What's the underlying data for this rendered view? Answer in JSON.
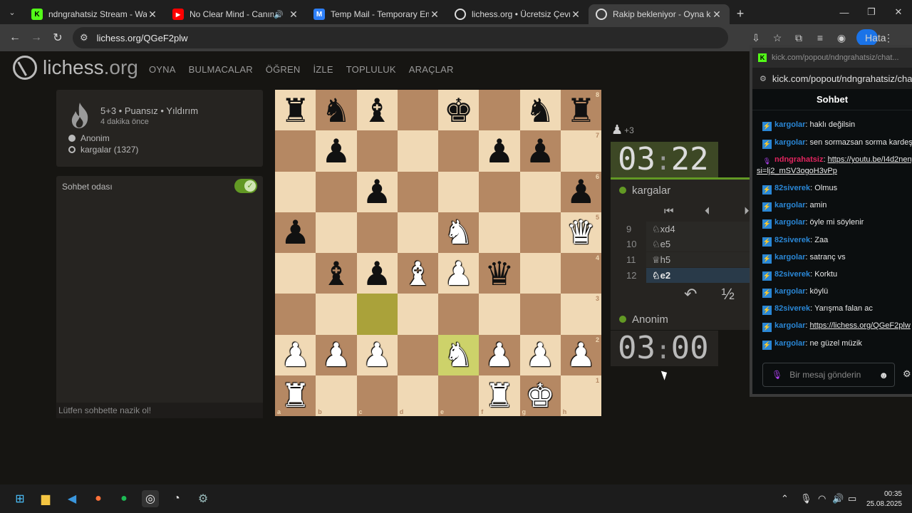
{
  "browser": {
    "tabs": [
      {
        "title": "ndngrahatsiz Stream - Watch Li",
        "favicon": "kick",
        "active": false
      },
      {
        "title": "No Clear Mind - Canım Kar",
        "favicon": "youtube",
        "active": false,
        "audio": true
      },
      {
        "title": "Temp Mail - Temporary Email",
        "favicon": "mail",
        "active": false
      },
      {
        "title": "lichess.org • Ücretsiz Çevrimiçi",
        "favicon": "lichess",
        "active": false
      },
      {
        "title": "Rakip bekleniyor - Oyna kargala",
        "favicon": "lichess",
        "active": true
      }
    ],
    "url": "lichess.org/QGeF2plw",
    "profile_label": "Hata"
  },
  "lichess": {
    "logo_text": "lichess",
    "logo_tld": ".org",
    "menu": [
      "OYNA",
      "BULMACALAR",
      "ÖĞREN",
      "İZLE",
      "TOPLULUK",
      "ARAÇLAR"
    ],
    "game": {
      "meta": "5+3 • Puansız • Yıldırım",
      "ago": "4 dakika önce",
      "white_player": "Anonim",
      "black_player": "kargalar (1327)"
    },
    "chat": {
      "title": "Sohbet odası",
      "placeholder": "Lütfen sohbette nazik ol!"
    },
    "board": {
      "files": [
        "a",
        "b",
        "c",
        "d",
        "e",
        "f",
        "g",
        "h"
      ],
      "ranks": [
        "8",
        "7",
        "6",
        "5",
        "4",
        "3",
        "2",
        "1"
      ],
      "position": [
        [
          "bR",
          "bN",
          "bB",
          "",
          "bK",
          "",
          "bN",
          "bR"
        ],
        [
          "",
          "bP",
          "",
          "",
          "",
          "bP",
          "bP",
          ""
        ],
        [
          "",
          "",
          "bP",
          "",
          "",
          "",
          "",
          "bP"
        ],
        [
          "bP",
          "",
          "",
          "",
          "wN",
          "",
          "",
          "wQ"
        ],
        [
          "",
          "bB",
          "bP",
          "wB",
          "wP",
          "bQ",
          "",
          ""
        ],
        [
          "",
          "",
          "",
          "",
          "",
          "",
          "",
          ""
        ],
        [
          "wP",
          "wP",
          "wP",
          "",
          "wN",
          "wP",
          "wP",
          "wP"
        ],
        [
          "wR",
          "",
          "",
          "",
          "",
          "wR",
          "wK",
          ""
        ]
      ],
      "last_move_from": "c3",
      "last_move_to": "e2"
    },
    "material_diff": "+3",
    "top_clock": {
      "min": "03",
      "sec": "22"
    },
    "top_player": "kargalar",
    "bottom_clock": {
      "min": "03",
      "sec": "00"
    },
    "bottom_player": "Anonim",
    "moves": [
      {
        "num": "9",
        "move": "♘xd4"
      },
      {
        "num": "10",
        "move": "♘e5"
      },
      {
        "num": "11",
        "move": "♕h5"
      },
      {
        "num": "12",
        "move": "♘e2",
        "current": true
      }
    ],
    "draw_label": "½"
  },
  "kick": {
    "window_title": "kick.com/popout/ndngrahatsiz/chat...",
    "url": "kick.com/popout/ndngrahatsiz/chat",
    "header": "Sohbet",
    "messages": [
      {
        "user": "kargolar",
        "text": "haklı değilsin",
        "color": "#2a87d6"
      },
      {
        "user": "kargolar",
        "text": "sen sormazsan sorma kardeşim",
        "color": "#2a87d6"
      },
      {
        "user": "ndngrahatsiz",
        "text": "https://youtu.be/I4d2neny",
        "color": "#e0245e",
        "mic": true
      },
      {
        "user": "",
        "text": "si=lj2_mSV3ogoH3vPp",
        "color": "#e8e8e8",
        "link": true
      },
      {
        "user": "82siverek",
        "text": "Olmus",
        "color": "#2a87d6"
      },
      {
        "user": "kargolar",
        "text": "amin",
        "color": "#2a87d6"
      },
      {
        "user": "kargolar",
        "text": "öyle mi söylenir",
        "color": "#2a87d6"
      },
      {
        "user": "82siverek",
        "text": "Zaa",
        "color": "#2a87d6"
      },
      {
        "user": "kargolar",
        "text": "satranç vs",
        "color": "#2a87d6"
      },
      {
        "user": "82siverek",
        "text": "Korktu",
        "color": "#2a87d6"
      },
      {
        "user": "kargolar",
        "text": "köylü",
        "color": "#2a87d6"
      },
      {
        "user": "82siverek",
        "text": "Yarışma falan ac",
        "color": "#2a87d6"
      },
      {
        "user": "kargolar",
        "text": "https://lichess.org/QGeF2plw",
        "color": "#2a87d6",
        "link": true
      },
      {
        "user": "kargolar",
        "text": "ne güzel müzik",
        "color": "#2a87d6"
      }
    ],
    "input_placeholder": "Bir mesaj gönderin"
  },
  "taskbar": {
    "time": "00:35",
    "date": "25.08.2025"
  }
}
